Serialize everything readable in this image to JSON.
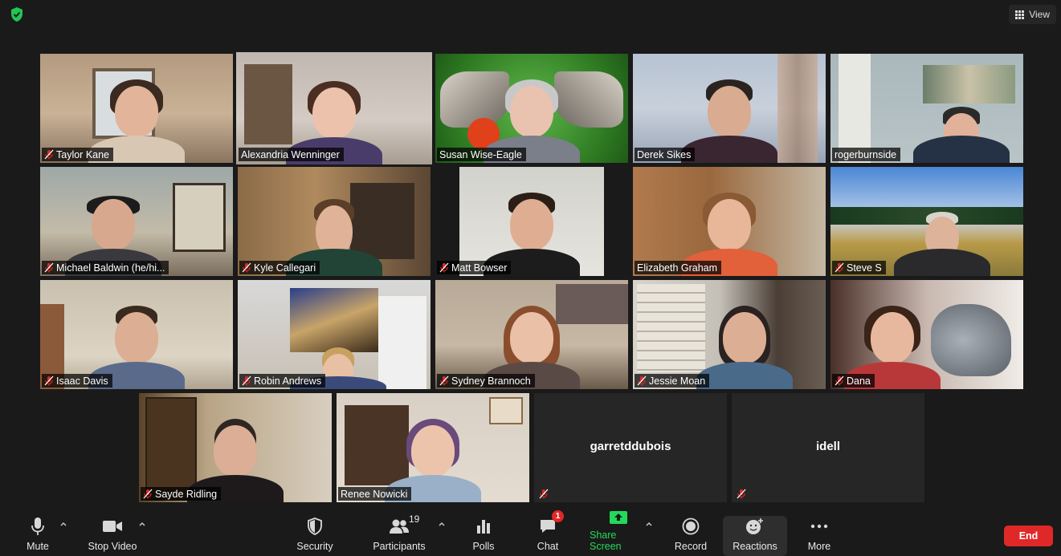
{
  "window": {
    "view_label": "View",
    "colors": {
      "background": "#1a1a1a",
      "active_speaker": "#dff05a",
      "share_green": "#23d959",
      "end_red": "#e02828"
    }
  },
  "participants": [
    {
      "name": "Taylor Kane",
      "muted": true,
      "active": false
    },
    {
      "name": "Alexandria Wenninger",
      "muted": false,
      "active": true
    },
    {
      "name": "Susan Wise-Eagle",
      "muted": false,
      "active": false
    },
    {
      "name": "Derek Sikes",
      "muted": false,
      "active": false
    },
    {
      "name": "rogerburnside",
      "muted": false,
      "active": false
    },
    {
      "name": "Michael Baldwin (he/hi...",
      "muted": true,
      "active": false
    },
    {
      "name": "Kyle Callegari",
      "muted": true,
      "active": false
    },
    {
      "name": "Matt Bowser",
      "muted": true,
      "active": false
    },
    {
      "name": "Elizabeth Graham",
      "muted": false,
      "active": false
    },
    {
      "name": "Steve S",
      "muted": true,
      "active": false
    },
    {
      "name": "Isaac Davis",
      "muted": true,
      "active": false
    },
    {
      "name": "Robin Andrews",
      "muted": true,
      "active": false
    },
    {
      "name": "Sydney Brannoch",
      "muted": true,
      "active": false
    },
    {
      "name": "Jessie Moan",
      "muted": true,
      "active": false
    },
    {
      "name": "Dana",
      "muted": true,
      "active": false
    },
    {
      "name": "Sayde Ridling",
      "muted": true,
      "active": false
    },
    {
      "name": "Renee Nowicki",
      "muted": false,
      "active": false
    },
    {
      "name": "garretddubois",
      "muted": true,
      "active": false,
      "video_off": true
    },
    {
      "name": "idell",
      "muted": true,
      "active": false,
      "video_off": true
    }
  ],
  "toolbar": {
    "mute_label": "Mute",
    "stop_video_label": "Stop Video",
    "security_label": "Security",
    "participants_label": "Participants",
    "participants_count": "19",
    "polls_label": "Polls",
    "chat_label": "Chat",
    "chat_badge": "1",
    "share_screen_label": "Share Screen",
    "record_label": "Record",
    "reactions_label": "Reactions",
    "more_label": "More",
    "end_label": "End"
  },
  "icons": {
    "security_badge": "shield-check-icon",
    "view": "grid-icon",
    "mute": "microphone-icon",
    "video": "video-camera-icon",
    "security": "shield-icon",
    "participants": "people-icon",
    "polls": "bar-chart-icon",
    "chat": "chat-bubble-icon",
    "share": "share-screen-icon",
    "record": "record-icon",
    "reactions": "smiley-plus-icon",
    "more": "ellipsis-icon",
    "muted": "mic-muted-icon"
  }
}
